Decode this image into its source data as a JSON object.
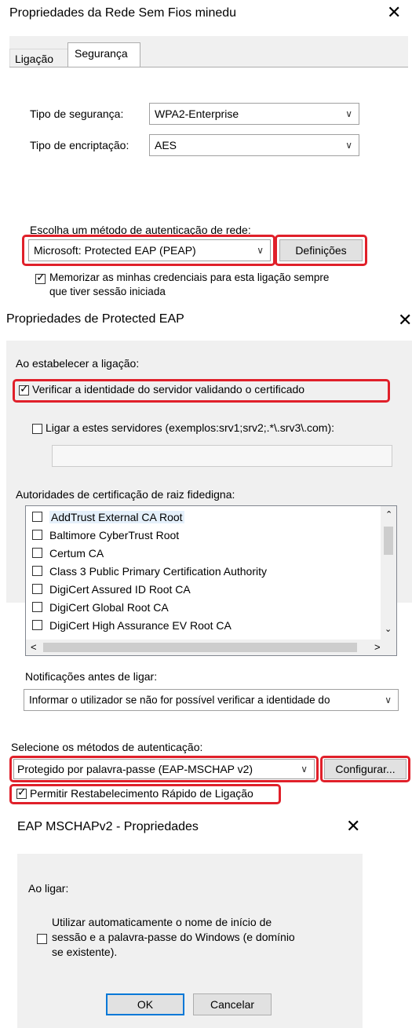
{
  "dialog1": {
    "title": "Propriedades da Rede Sem Fios minedu",
    "tabs": [
      "Ligação",
      "Segurança"
    ],
    "security_type_label": "Tipo de segurança:",
    "security_type_value": "WPA2-Enterprise",
    "encryption_type_label": "Tipo de encriptação:",
    "encryption_type_value": "AES",
    "auth_method_label": "Escolha um método de autenticação de rede:",
    "auth_method_value": "Microsoft: Protected EAP (PEAP)",
    "settings_button": "Definições",
    "remember_line1": "Memorizar as minhas credenciais para esta ligação sempre",
    "remember_line2": "que tiver sessão iniciada",
    "remember_checked": true
  },
  "dialog2": {
    "title": "Propriedades de Protected EAP",
    "when_connecting_label": "Ao estabelecer a ligação:",
    "verify_identity_label": "Verificar a identidade do servidor validando o certificado",
    "verify_identity_checked": true,
    "connect_servers_label": "Ligar a estes servidores (exemplos:srv1;srv2;.*\\.srv3\\.com):",
    "connect_servers_checked": false,
    "servers_input_value": "",
    "trusted_roots_label": "Autoridades de certificação de raiz fidedigna:",
    "trusted_roots": [
      "AddTrust External CA Root",
      "Baltimore CyberTrust Root",
      "Certum CA",
      "Class 3 Public Primary Certification Authority",
      "DigiCert Assured ID Root CA",
      "DigiCert Global Root CA",
      "DigiCert High Assurance EV Root CA"
    ],
    "notifications_label": "Notificações antes de ligar:",
    "notifications_value": "Informar o utilizador se não for possível verificar a identidade do",
    "auth_methods_label": "Selecione os métodos de autenticação:",
    "auth_method_value": "Protegido por palavra-passe (EAP-MSCHAP v2)",
    "configure_button": "Configurar...",
    "fast_reconnect_label": "Permitir Restabelecimento Rápido de Ligação",
    "fast_reconnect_checked": true
  },
  "dialog3": {
    "title": "EAP MSCHAPv2 - Propriedades",
    "when_connecting_label": "Ao ligar:",
    "auto_use_line1": "Utilizar automaticamente o nome de início de",
    "auto_use_line2": "sessão e a palavra-passe do Windows (e domínio",
    "auto_use_line3": "se existente).",
    "auto_use_checked": false,
    "ok_button": "OK",
    "cancel_button": "Cancelar"
  },
  "colors": {
    "highlight": "#e0202a",
    "panel": "#f0f0f0"
  }
}
